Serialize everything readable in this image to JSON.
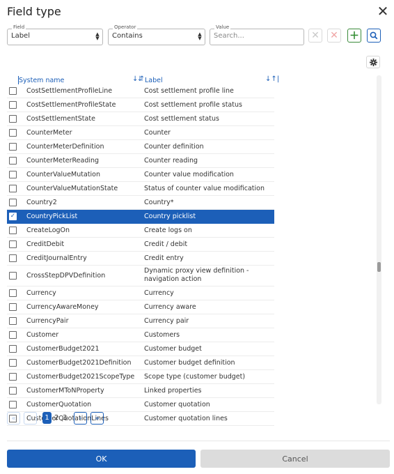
{
  "dialog": {
    "title": "Field type",
    "close_symbol": "✕"
  },
  "filter": {
    "field": {
      "legend": "Field",
      "value": "Label"
    },
    "operator": {
      "legend": "Operator",
      "value": "Contains"
    },
    "value": {
      "legend": "Value",
      "placeholder": "Search..."
    }
  },
  "table": {
    "columns": [
      "System name",
      "Label"
    ],
    "rows": [
      {
        "system": "CostSettlementProfileLine",
        "label": "Cost settlement profile line"
      },
      {
        "system": "CostSettlementProfileState",
        "label": "Cost settlement profile status"
      },
      {
        "system": "CostSettlementState",
        "label": "Cost settlement status"
      },
      {
        "system": "CounterMeter",
        "label": "Counter"
      },
      {
        "system": "CounterMeterDefinition",
        "label": "Counter definition"
      },
      {
        "system": "CounterMeterReading",
        "label": "Counter reading"
      },
      {
        "system": "CounterValueMutation",
        "label": "Counter value modification"
      },
      {
        "system": "CounterValueMutationState",
        "label": "Status of counter value modification"
      },
      {
        "system": "Country2",
        "label": "Country*"
      },
      {
        "system": "CountryPickList",
        "label": "Country picklist",
        "selected": true
      },
      {
        "system": "CreateLogOn",
        "label": "Create logs on"
      },
      {
        "system": "CreditDebit",
        "label": "Credit / debit"
      },
      {
        "system": "CreditJournalEntry",
        "label": "Credit entry"
      },
      {
        "system": "CrossStepDPVDefinition",
        "label": "Dynamic proxy view definition - navigation action",
        "tall": true
      },
      {
        "system": "Currency",
        "label": "Currency"
      },
      {
        "system": "CurrencyAwareMoney",
        "label": "Currency aware"
      },
      {
        "system": "CurrencyPair",
        "label": "Currency pair"
      },
      {
        "system": "Customer",
        "label": "Customers"
      },
      {
        "system": "CustomerBudget2021",
        "label": "Customer budget"
      },
      {
        "system": "CustomerBudget2021Definition",
        "label": "Customer budget definition"
      },
      {
        "system": "CustomerBudget2021ScopeType",
        "label": "Scope type (customer budget)"
      },
      {
        "system": "CustomerMToNProperty",
        "label": "Linked properties"
      },
      {
        "system": "CustomerQuotation",
        "label": "Customer quotation"
      },
      {
        "system": "CustomerQuotationLines",
        "label": "Customer quotation lines"
      }
    ]
  },
  "pagination": {
    "pages": [
      "1",
      "2",
      "3"
    ],
    "current": "1"
  },
  "footer": {
    "ok_label": "OK",
    "cancel_label": "Cancel"
  },
  "colors": {
    "accent": "#1c5fb8",
    "selected_row": "#1c5fb8",
    "add_green": "#2e8b2e",
    "clear_red": "#f0a6a6"
  },
  "icons": [
    "close-icon",
    "clear-icon",
    "add-icon",
    "search-icon",
    "gear-icon",
    "sort-icon",
    "first-page-icon",
    "prev-page-icon",
    "next-page-icon",
    "last-page-icon"
  ]
}
